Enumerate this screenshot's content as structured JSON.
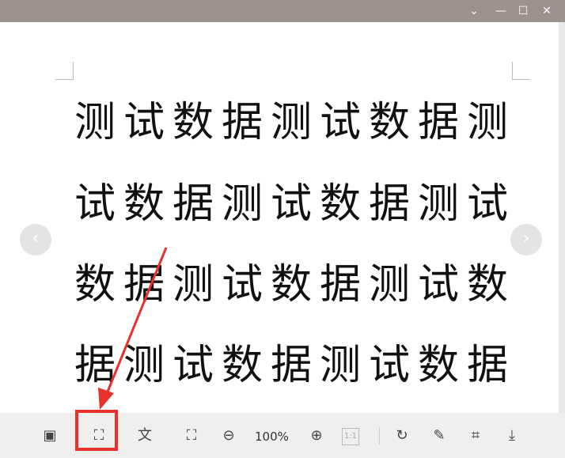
{
  "window": {
    "controls": [
      "chevron-down",
      "minimize",
      "maximize",
      "close"
    ]
  },
  "document": {
    "rows": [
      "测试数据测试数据测",
      "试数据测试数据测试",
      "数据测试数据测试数",
      "据测试数据测试数据"
    ]
  },
  "toolbar": {
    "zoom_level": "100%",
    "actual_size_label": "1:1"
  },
  "annotation": {
    "color": "#e8302c"
  }
}
